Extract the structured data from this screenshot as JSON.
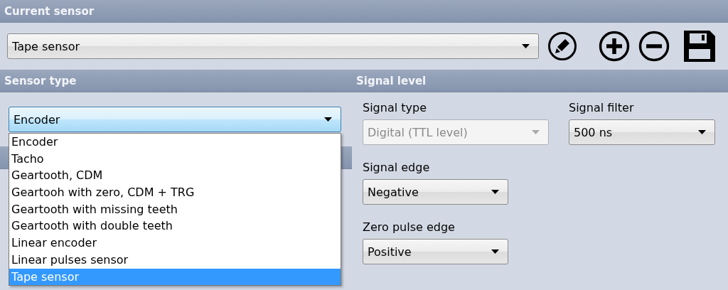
{
  "current_sensor": {
    "title": "Current sensor",
    "value": "Tape sensor"
  },
  "sensor_type": {
    "title": "Sensor type",
    "value": "Encoder",
    "expanded": true,
    "options": [
      {
        "label": "Encoder",
        "highlighted": false
      },
      {
        "label": "Tacho",
        "highlighted": false
      },
      {
        "label": "Geartooth, CDM",
        "highlighted": false
      },
      {
        "label": "Geartooh with zero, CDM + TRG",
        "highlighted": false
      },
      {
        "label": "Geartooth with missing teeth",
        "highlighted": false
      },
      {
        "label": "Geartooth with double teeth",
        "highlighted": false
      },
      {
        "label": "Linear encoder",
        "highlighted": false
      },
      {
        "label": "Linear pulses sensor",
        "highlighted": false
      },
      {
        "label": "Tape sensor",
        "highlighted": true
      }
    ]
  },
  "signal_level": {
    "title": "Signal level",
    "fields": [
      {
        "label": "Signal type",
        "value": "Digital (TTL level)",
        "disabled": true
      },
      {
        "label": "Signal filter",
        "value": "500 ns",
        "disabled": false
      },
      {
        "label": "Signal edge",
        "value": "Negative",
        "disabled": false
      },
      {
        "label": "Zero pulse edge",
        "value": "Positive",
        "disabled": false
      }
    ]
  }
}
